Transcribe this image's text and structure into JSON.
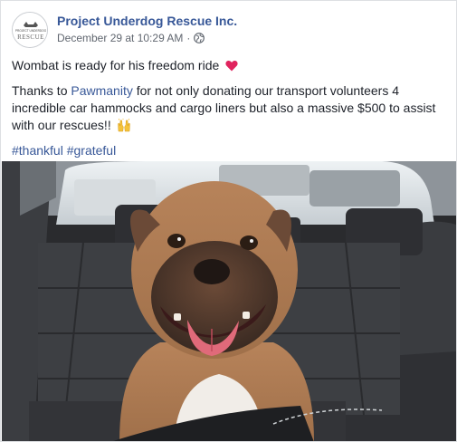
{
  "post": {
    "page_name": "Project Underdog Rescue Inc.",
    "avatar_logo_text": [
      "PROJECT UNDERDOG",
      "RESCUE"
    ],
    "date": "December 29 at 10:29 AM",
    "separator": "·",
    "privacy_icon": "globe-icon",
    "line1": "Wombat is ready for his freedom ride",
    "line1_emoji": "heart-icon",
    "line2_prefix": "Thanks to ",
    "line2_link": "Pawmanity",
    "line2_suffix": " for not only donating our transport volunteers 4 incredible car hammocks and cargo liners but also a massive $500 to assist with our rescues!!",
    "line2_emoji": "raised-hands-icon",
    "hashtag1": "#thankful",
    "hashtag2": "#grateful",
    "photo_subject": "dog-in-car-photo",
    "colors": {
      "link": "#385898",
      "text": "#1d2129",
      "meta": "#616770",
      "heart": "#e0245e"
    }
  }
}
